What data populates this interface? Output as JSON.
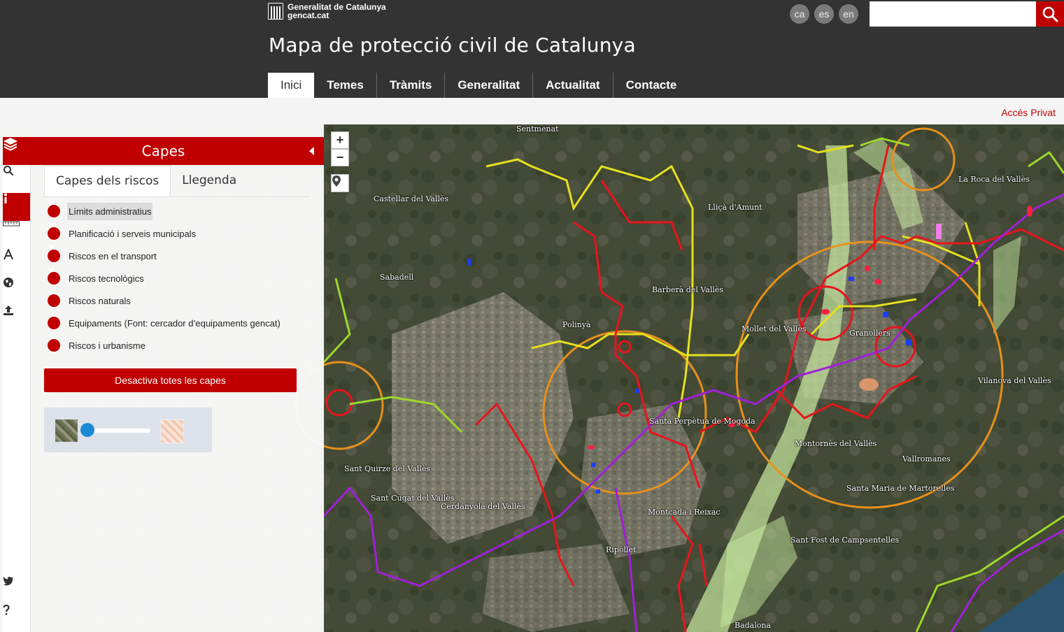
{
  "header": {
    "logo_line1": "Generalitat de Catalunya",
    "logo_line2": "gencat.cat",
    "title": "Mapa de protecció civil de Catalunya",
    "languages": [
      "ca",
      "es",
      "en"
    ],
    "search": {
      "value": "",
      "placeholder": ""
    },
    "nav": [
      "Inici",
      "Temes",
      "Tràmits",
      "Generalitat",
      "Actualitat",
      "Contacte"
    ],
    "nav_active": "Inici"
  },
  "subbar": {
    "private_access": "Accés Privat"
  },
  "panel": {
    "title": "Capes",
    "tabs": [
      "Capes dels riscos",
      "Llegenda"
    ],
    "active_tab": "Capes dels riscos",
    "layers": [
      "Límits administratius",
      "Planificació i serveis municipals",
      "Riscos en el transport",
      "Riscos tecnològics",
      "Riscos naturals",
      "Equipaments (Font: cercador d’equipaments gencat)",
      "Riscos i urbanisme"
    ],
    "deactivate_button": "Desactiva totes les capes",
    "opacity_value": 0.0
  },
  "tools": [
    "search-icon",
    "info-icon",
    "ruler-icon",
    "text-icon",
    "globe-icon",
    "upload-icon",
    "twitter-icon",
    "help-icon"
  ],
  "map": {
    "zoom_in": "+",
    "zoom_out": "−",
    "labels": [
      "Castellar del Vallès",
      "Sabadell",
      "Barberà del Vallès",
      "Montcada i Reixac",
      "Santa Perpètua de Mogoda",
      "Mollet del Vallès",
      "Granollers",
      "Sant Quirze del Vallès",
      "Cerdanyola del Vallès",
      "Ripollet",
      "Vallromanes",
      "Montornès del Vallès",
      "Sant Fost de Campsentelles",
      "Santa Maria de Martorelles",
      "Lliçà d'Amunt",
      "Sentmenat",
      "Polinyà",
      "La Roca del Vallès",
      "Vilanova del Vallès",
      "Sant Cugat del Vallès",
      "Badalona"
    ]
  },
  "colors": {
    "accent": "#c00000",
    "header_bg": "#333333",
    "risk_red": "#e8141c",
    "risk_orange": "#e8901c",
    "risk_yellow": "#e6e020",
    "risk_purple": "#a020d8",
    "risk_green": "#9cd82c"
  }
}
